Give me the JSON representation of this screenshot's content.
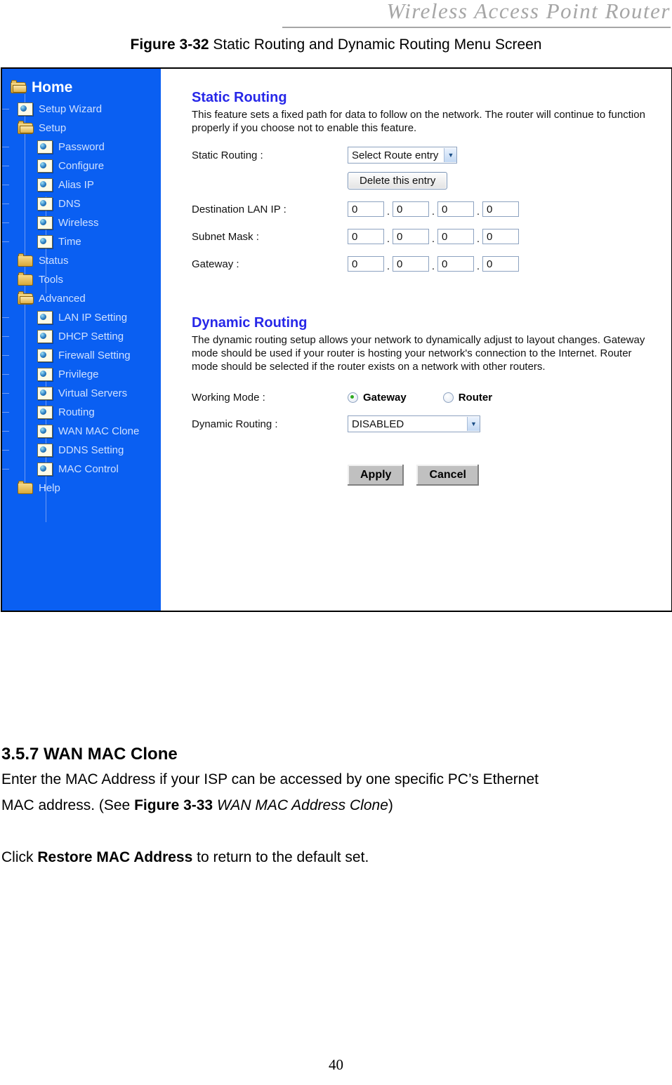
{
  "document": {
    "running_header": "Wireless  Access  Point  Router",
    "figure_caption_label": "Figure 3-32",
    "figure_caption_text": " Static Routing and Dynamic Routing Menu Screen",
    "page_number": "40"
  },
  "sidebar": {
    "home": {
      "label": "Home",
      "icon": "folder-open-icon"
    },
    "items": [
      {
        "label": "Setup Wizard",
        "icon": "page-icon",
        "level": 1,
        "expander": null
      },
      {
        "label": "Setup",
        "icon": "folder-open-icon",
        "level": 1,
        "expander": "minus"
      },
      {
        "label": "Password",
        "icon": "page-icon",
        "level": 2,
        "expander": null
      },
      {
        "label": "Configure",
        "icon": "page-icon",
        "level": 2,
        "expander": null
      },
      {
        "label": "Alias IP",
        "icon": "page-icon",
        "level": 2,
        "expander": null
      },
      {
        "label": "DNS",
        "icon": "page-icon",
        "level": 2,
        "expander": null
      },
      {
        "label": "Wireless",
        "icon": "page-icon",
        "level": 2,
        "expander": null
      },
      {
        "label": "Time",
        "icon": "page-icon",
        "level": 2,
        "expander": null
      },
      {
        "label": "Status",
        "icon": "folder-closed-icon",
        "level": 1,
        "expander": "plus"
      },
      {
        "label": "Tools",
        "icon": "folder-closed-icon",
        "level": 1,
        "expander": "plus"
      },
      {
        "label": "Advanced",
        "icon": "folder-open-icon",
        "level": 1,
        "expander": "minus"
      },
      {
        "label": "LAN IP Setting",
        "icon": "page-icon",
        "level": 2,
        "expander": null
      },
      {
        "label": "DHCP Setting",
        "icon": "page-icon",
        "level": 2,
        "expander": null
      },
      {
        "label": "Firewall Setting",
        "icon": "page-icon",
        "level": 2,
        "expander": null
      },
      {
        "label": "Privilege",
        "icon": "page-icon",
        "level": 2,
        "expander": null
      },
      {
        "label": "Virtual Servers",
        "icon": "page-icon",
        "level": 2,
        "expander": null
      },
      {
        "label": "Routing",
        "icon": "page-icon",
        "level": 2,
        "expander": null
      },
      {
        "label": "WAN MAC Clone",
        "icon": "page-icon",
        "level": 2,
        "expander": null
      },
      {
        "label": "DDNS Setting",
        "icon": "page-icon",
        "level": 2,
        "expander": null
      },
      {
        "label": "MAC Control",
        "icon": "page-icon",
        "level": 2,
        "expander": null
      },
      {
        "label": "Help",
        "icon": "folder-closed-icon",
        "level": 1,
        "expander": "plus"
      }
    ]
  },
  "static_routing": {
    "title": "Static Routing",
    "description": "This feature sets a fixed path for data to follow on the network. The router will continue to function properly if you choose not to enable this feature.",
    "route_label": "Static Routing :",
    "route_select_value": "Select Route entry",
    "delete_button": "Delete this entry",
    "destination_label": "Destination LAN IP :",
    "destination_octets": [
      "0",
      "0",
      "0",
      "0"
    ],
    "subnet_label": "Subnet Mask :",
    "subnet_octets": [
      "0",
      "0",
      "0",
      "0"
    ],
    "gateway_label": "Gateway :",
    "gateway_octets": [
      "0",
      "0",
      "0",
      "0"
    ]
  },
  "dynamic_routing": {
    "title": "Dynamic Routing",
    "description": "The dynamic routing setup allows your network to dynamically adjust to layout changes. Gateway mode should be used if your router is hosting your network's connection to the Internet. Router mode should be selected if the router exists on a network with other routers.",
    "working_mode_label": "Working Mode :",
    "radio_gateway": "Gateway",
    "radio_router": "Router",
    "selected_mode": "Gateway",
    "dynamic_routing_label": "Dynamic Routing :",
    "dynamic_routing_value": "DISABLED",
    "apply_button": "Apply",
    "cancel_button": "Cancel"
  },
  "body": {
    "heading": "3.5.7 WAN MAC Clone",
    "para1_a": "Enter the MAC Address if your ISP can be accessed by one specific PC’s Ethernet",
    "para1_b": "MAC address. (See ",
    "para1_bold": "Figure 3-33",
    "para1_italic": " WAN MAC Address Clone",
    "para1_c": ")",
    "para2_a": "Click ",
    "para2_bold": "Restore MAC Address",
    "para2_b": " to return to the default set."
  },
  "colors": {
    "sidebar_blue": "#0a5ff2",
    "section_heading_blue": "#2727e8",
    "radio_selected_green": "#2faa20",
    "header_gray": "#a6a6a6"
  }
}
